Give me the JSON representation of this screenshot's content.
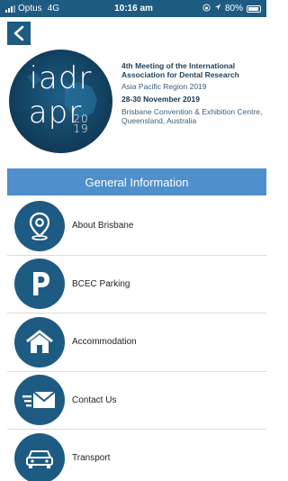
{
  "status_bar": {
    "carrier": "Optus",
    "network": "4G",
    "time": "10:16 am",
    "battery": "80%"
  },
  "conference": {
    "logo_lines": [
      "iadr",
      "apr",
      "20",
      "19"
    ],
    "title": "4th Meeting of the International Association for Dental Research",
    "region": "Asia Pacific Region 2019",
    "dates": "28-30 November 2019",
    "venue": "Brisbane Convention & Exhibition Centre, Queensland, Australia"
  },
  "section": {
    "title": "General Information"
  },
  "menu": {
    "items": [
      {
        "label": "About Brisbane",
        "icon": "map-pin-icon"
      },
      {
        "label": "BCEC Parking",
        "icon": "parking-icon"
      },
      {
        "label": "Accommodation",
        "icon": "house-icon"
      },
      {
        "label": "Contact Us",
        "icon": "envelope-icon"
      },
      {
        "label": "Transport",
        "icon": "car-icon"
      }
    ]
  },
  "colors": {
    "primary": "#1e5b83",
    "header": "#4f8fcb"
  }
}
